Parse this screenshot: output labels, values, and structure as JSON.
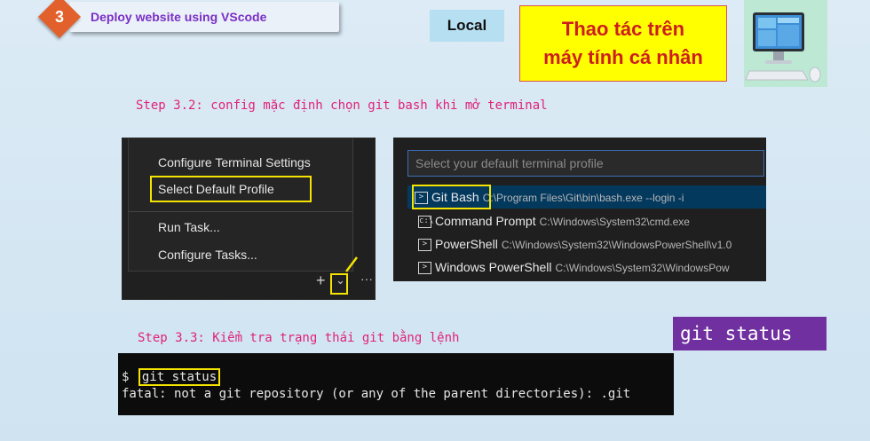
{
  "header": {
    "step_number": "3",
    "step_title": "Deploy website using VScode",
    "location_label": "Local",
    "note_line1": "Thao tác trên",
    "note_line2": "máy tính cá nhân",
    "computer_image": "desktop-computer-illustration"
  },
  "step_3_2": {
    "text": "Step 3.2: config mặc định chọn git bash khi mở terminal"
  },
  "terminal_menu": {
    "items": [
      {
        "label": "Configure Terminal Settings",
        "highlighted": false
      },
      {
        "label": "Select Default Profile",
        "highlighted": true
      },
      {
        "label": "Run Task...",
        "highlighted": false
      },
      {
        "label": "Configure Tasks...",
        "highlighted": false
      }
    ],
    "toolbar_icons": [
      "plus-icon",
      "chevron-down-icon",
      "more-icon"
    ]
  },
  "profile_picker": {
    "placeholder": "Select your default terminal profile",
    "profiles": [
      {
        "name": "Git Bash",
        "path": "C:\\Program Files\\Git\\bin\\bash.exe --login -i",
        "icon": "terminal-icon",
        "selected": true
      },
      {
        "name": "Command Prompt",
        "path": "C:\\Windows\\System32\\cmd.exe",
        "icon": "cmd-icon",
        "selected": false
      },
      {
        "name": "PowerShell",
        "path": "C:\\Windows\\System32\\WindowsPowerShell\\v1.0",
        "icon": "terminal-icon",
        "selected": false
      },
      {
        "name": "Windows PowerShell",
        "path": "C:\\Windows\\System32\\WindowsPow",
        "icon": "terminal-icon",
        "selected": false
      }
    ]
  },
  "step_3_3": {
    "text": "Step 3.3: Kiểm tra trạng thái git bằng lệnh",
    "command_label": "git status"
  },
  "terminal_output": {
    "prompt": "$",
    "command": "git status",
    "output": "fatal: not a git repository (or any of the parent directories): .git"
  },
  "colors": {
    "accent_orange": "#e2602b",
    "highlight_yellow": "#f5e400",
    "step_pink": "#e0227a",
    "purple": "#7030a0"
  }
}
